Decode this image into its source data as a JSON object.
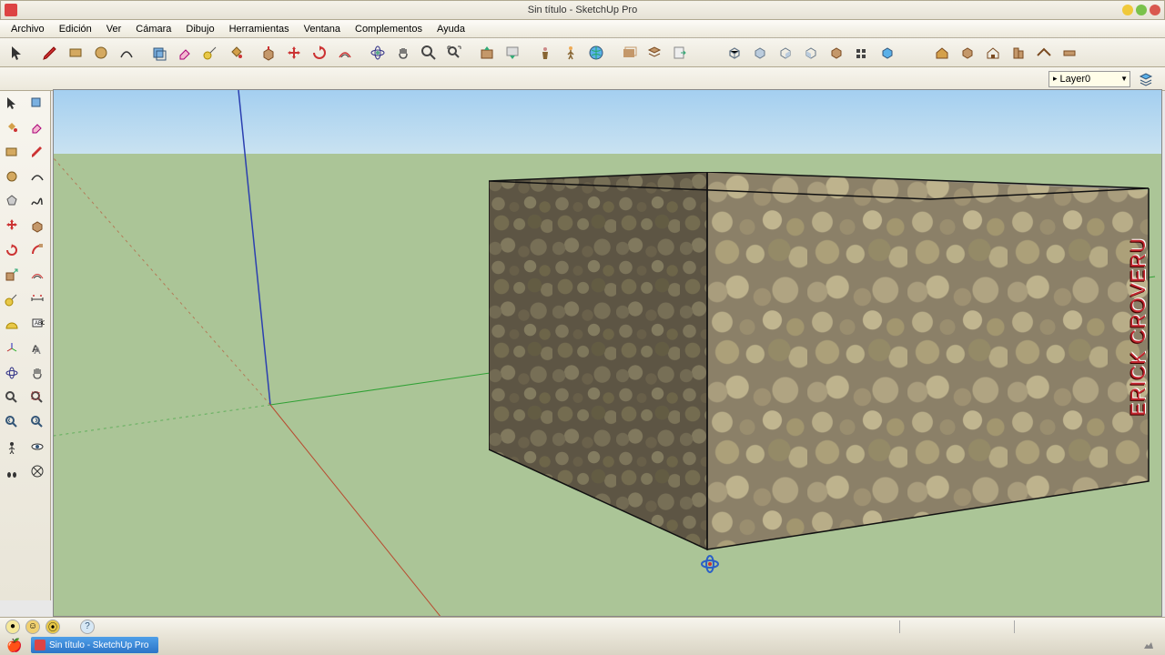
{
  "app": {
    "title": "Sin título - SketchUp Pro"
  },
  "window_controls": {
    "minimize_color": "#f0c93a",
    "maximize_color": "#7ac24b",
    "close_color": "#d9584f"
  },
  "menu": [
    "Archivo",
    "Edición",
    "Ver",
    "Cámara",
    "Dibujo",
    "Herramientas",
    "Ventana",
    "Complementos",
    "Ayuda"
  ],
  "layer": {
    "selected": "Layer0"
  },
  "taskbar": {
    "item": "Sin título - SketchUp Pro"
  },
  "watermark": "ERICK CROVERU",
  "colors": {
    "sky_top": "#a4cff0",
    "sky_bottom": "#c9e2f1",
    "ground": "#abc597",
    "axis_blue": "#2b3fb0",
    "axis_green": "#2fa034",
    "axis_red": "#b84a2f"
  },
  "status": {
    "help_icon": "?"
  }
}
